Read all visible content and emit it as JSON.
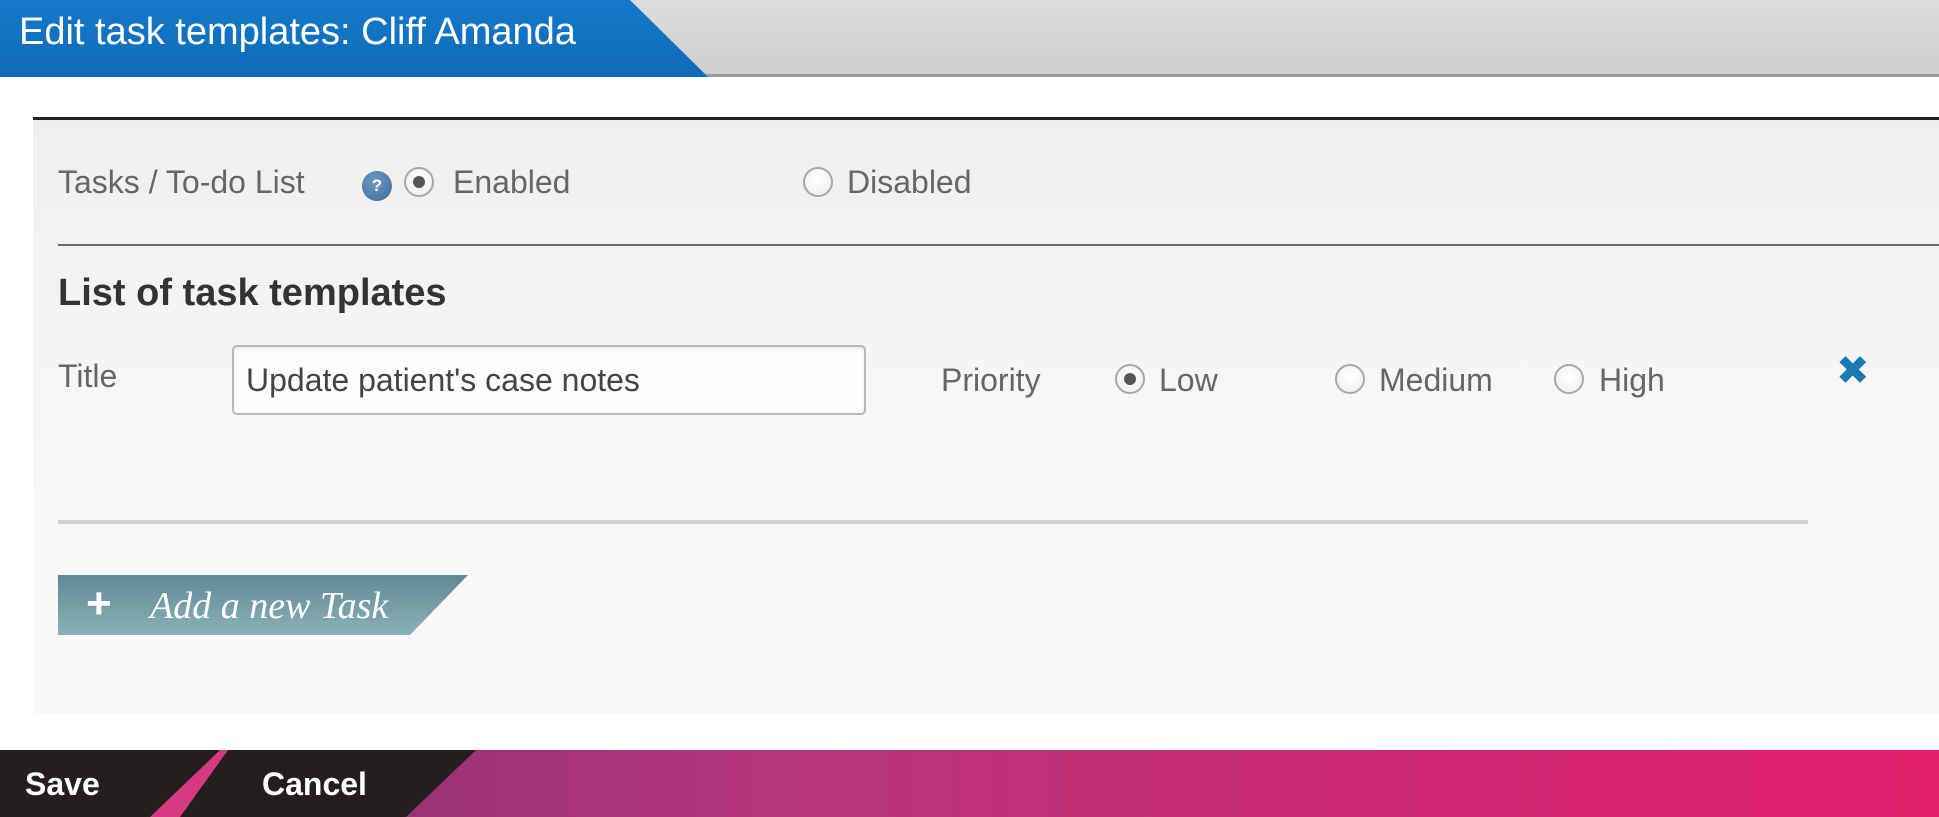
{
  "header": {
    "title": "Edit task templates: Cliff Amanda",
    "accent_color": "#0f6bb8"
  },
  "settings": {
    "tasks_label": "Tasks / To-do List",
    "help_icon": "?",
    "options": [
      {
        "label": "Enabled",
        "checked": true
      },
      {
        "label": "Disabled",
        "checked": false
      }
    ]
  },
  "template_list": {
    "heading": "List of task templates",
    "items": [
      {
        "title_label": "Title",
        "title_value": "Update patient's case notes",
        "priority_label": "Priority",
        "priorities": [
          {
            "label": "Low",
            "checked": true
          },
          {
            "label": "Medium",
            "checked": false
          },
          {
            "label": "High",
            "checked": false
          }
        ],
        "delete_icon": "close-icon"
      }
    ],
    "add_button": {
      "icon": "+",
      "label": "Add a new Task",
      "color": "#6f98a2"
    }
  },
  "footer": {
    "save_label": "Save",
    "cancel_label": "Cancel",
    "gradient_colors": [
      "#7e2f70",
      "#e21d6c"
    ]
  }
}
